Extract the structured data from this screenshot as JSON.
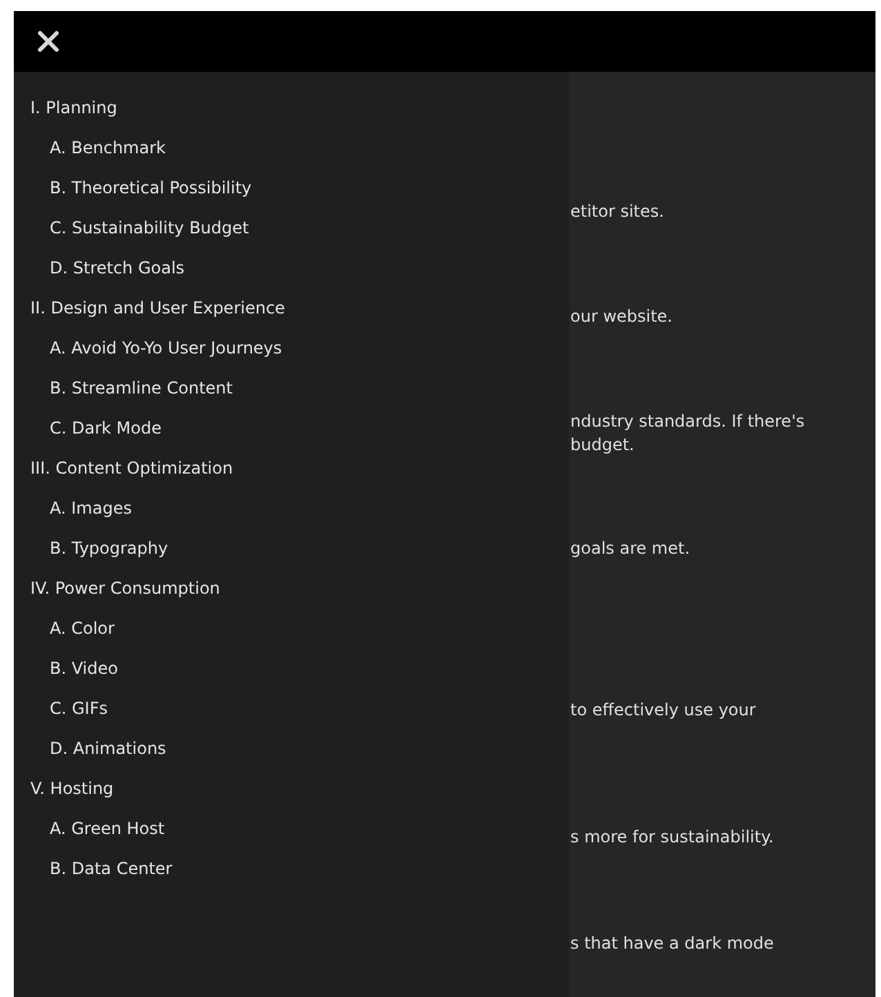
{
  "header": {
    "close_icon": true
  },
  "menu": [
    {
      "label": "I. Planning",
      "children": [
        {
          "label": "A. Benchmark"
        },
        {
          "label": "B. Theoretical Possibility"
        },
        {
          "label": "C. Sustainability Budget"
        },
        {
          "label": "D. Stretch Goals"
        }
      ]
    },
    {
      "label": "II. Design and User Experience",
      "children": [
        {
          "label": "A. Avoid Yo-Yo User Journeys"
        },
        {
          "label": "B. Streamline Content"
        },
        {
          "label": "C. Dark Mode"
        }
      ]
    },
    {
      "label": "III. Content Optimization",
      "children": [
        {
          "label": "A. Images"
        },
        {
          "label": "B. Typography"
        }
      ]
    },
    {
      "label": "IV. Power Consumption",
      "children": [
        {
          "label": "A. Color"
        },
        {
          "label": "B. Video"
        },
        {
          "label": "C. GIFs"
        },
        {
          "label": "D. Animations"
        }
      ]
    },
    {
      "label": "V. Hosting",
      "children": [
        {
          "label": "A. Green Host"
        },
        {
          "label": "B. Data Center"
        }
      ]
    }
  ],
  "content_fragments": [
    {
      "lines": [
        "etitor sites."
      ]
    },
    {
      "lines": [
        "our website."
      ]
    },
    {
      "lines": [
        "ndustry standards. If there's",
        "budget."
      ]
    },
    {
      "lines": [
        "goals are met."
      ]
    },
    {
      "lines": [
        "to effectively use your"
      ]
    },
    {
      "lines": [
        "s more for sustainability."
      ]
    },
    {
      "lines": [
        "s that have a dark mode"
      ]
    }
  ]
}
